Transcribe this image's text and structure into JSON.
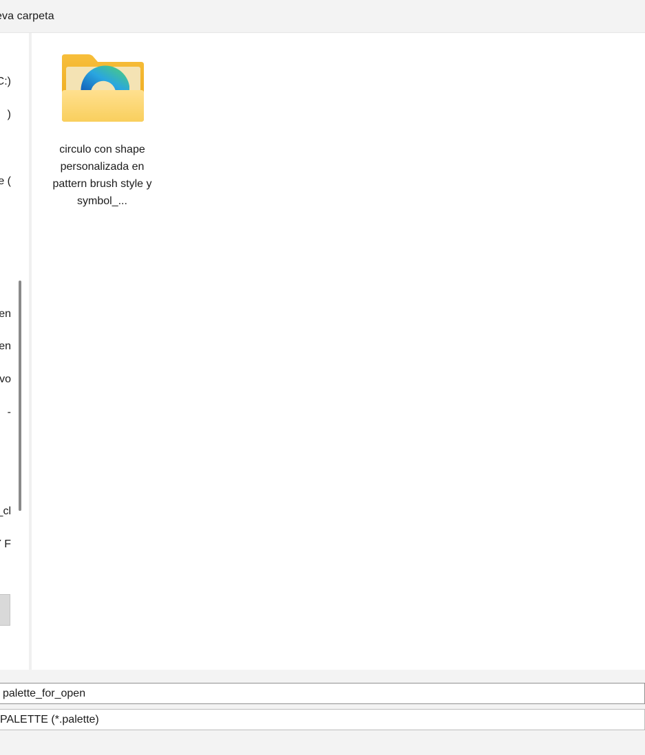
{
  "toolbar": {
    "new_folder_label": "eva carpeta"
  },
  "nav_pane": {
    "items": [
      {
        "label": "C:)"
      },
      {
        "label": ")"
      },
      {
        "label": "e ("
      },
      {
        "label": "en"
      },
      {
        "label": "en"
      },
      {
        "label": "ivo"
      },
      {
        "label": "-"
      },
      {
        "label": "_cl"
      },
      {
        "label": "Y F"
      }
    ]
  },
  "content": {
    "items": [
      {
        "name": "circulo con shape personalizada en pattern brush style y symbol_...",
        "type": "folder"
      }
    ]
  },
  "footer": {
    "file_name_value": "palette_for_open",
    "file_type_value": "PALETTE (*.palette)"
  },
  "colors": {
    "folder_back": "#f0b429",
    "folder_front": "#fcd77a",
    "accent_blue": "#1a73c8",
    "accent_green": "#3fd17a"
  }
}
